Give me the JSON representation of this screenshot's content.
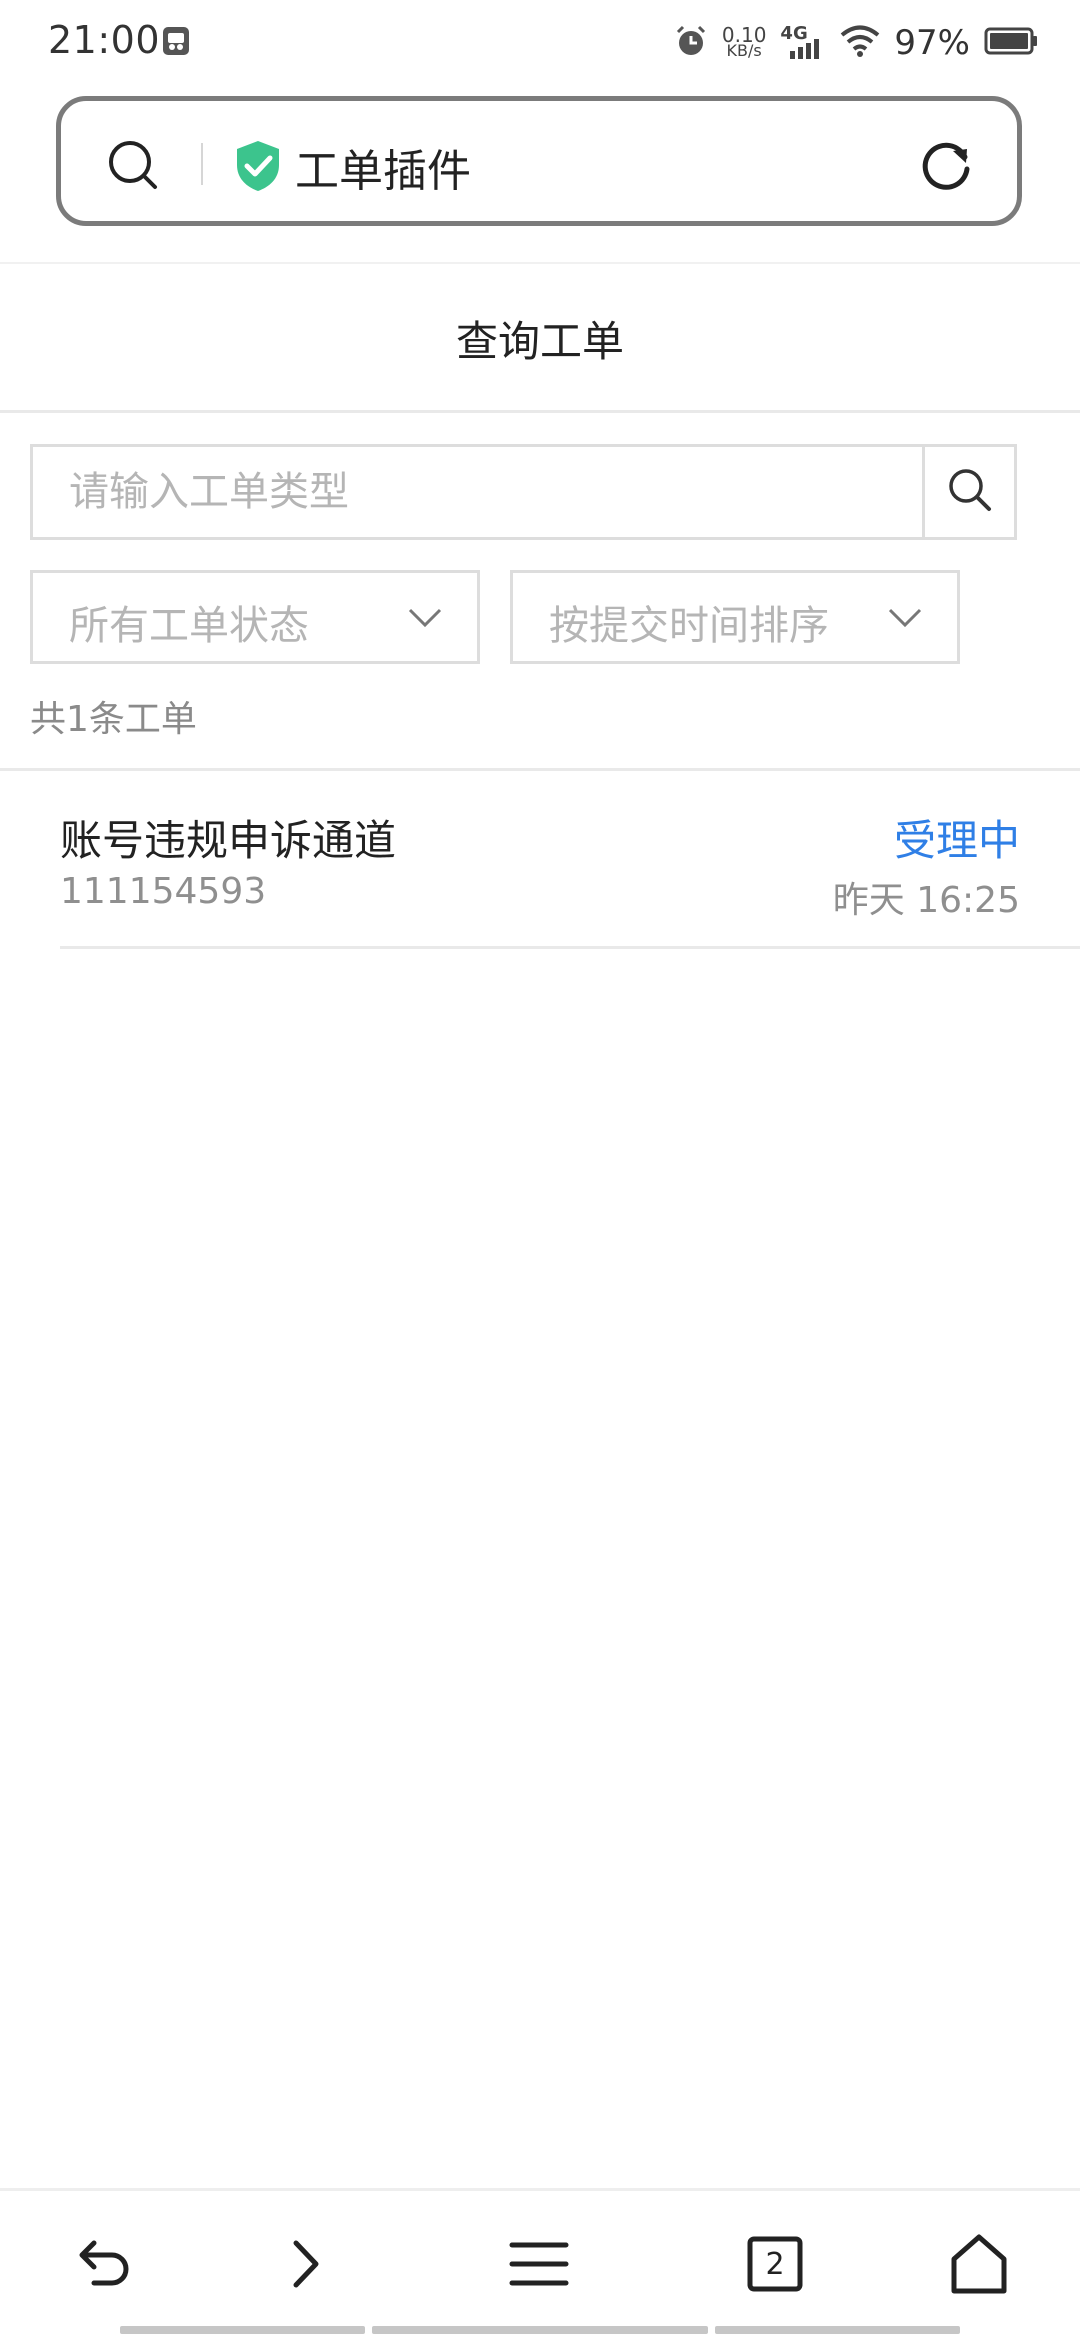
{
  "status_bar": {
    "time": "21:00",
    "net_speed_value": "0.10",
    "net_speed_unit": "KB/s",
    "network_type": "4G",
    "battery_percent": "97%",
    "icons": [
      "app-notification-icon",
      "alarm-icon",
      "signal-icon",
      "wifi-icon",
      "battery-icon"
    ]
  },
  "address_bar": {
    "title": "工单插件",
    "icons": [
      "search-icon",
      "shield-check-icon",
      "refresh-icon"
    ],
    "shield_color": "#3cc48d"
  },
  "page": {
    "title": "查询工单"
  },
  "search": {
    "placeholder": "请输入工单类型",
    "value": ""
  },
  "filters": {
    "status_label": "所有工单状态",
    "sort_label": "按提交时间排序"
  },
  "summary": {
    "count_text": "共1条工单"
  },
  "tickets": [
    {
      "title": "账号违规申诉通道",
      "id": "111154593",
      "status": "受理中",
      "time": "昨天 16:25",
      "status_color": "#2f7fe6"
    }
  ],
  "bottom_nav": {
    "items": [
      "back-icon",
      "forward-icon",
      "menu-icon",
      "tabs-icon",
      "home-icon"
    ],
    "tab_count": "2"
  }
}
